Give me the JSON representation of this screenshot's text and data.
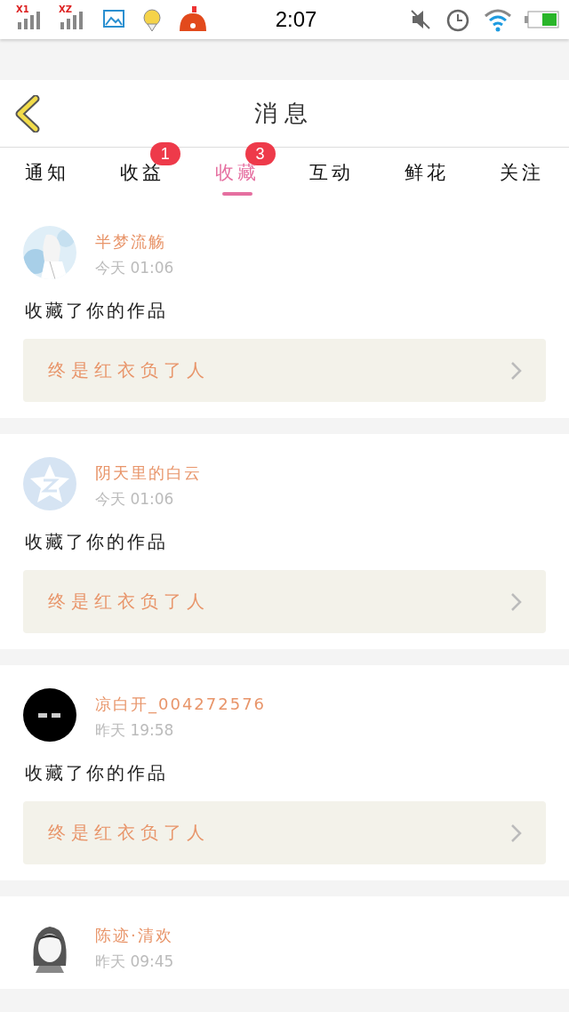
{
  "status_bar": {
    "sim_labels": [
      "X1",
      "XZ"
    ],
    "time": "2:07"
  },
  "header": {
    "title": "消息"
  },
  "tabs": [
    {
      "label": "通知",
      "selected": false
    },
    {
      "label": "收益",
      "selected": false,
      "badge": "1"
    },
    {
      "label": "收藏",
      "selected": true,
      "badge": "3"
    },
    {
      "label": "互动",
      "selected": false
    },
    {
      "label": "鲜花",
      "selected": false
    },
    {
      "label": "关注",
      "selected": false
    }
  ],
  "messages": [
    {
      "user": "半梦流觞",
      "time": "今天 01:06",
      "action": "收藏了你的作品",
      "work": "终是红衣负了人"
    },
    {
      "user": "阴天里的白云",
      "time": "今天 01:06",
      "action": "收藏了你的作品",
      "work": "终是红衣负了人",
      "avatar": {
        "kind": "default"
      }
    },
    {
      "user": "凉白开_004272576",
      "time": "昨天 19:58",
      "action": "收藏了你的作品",
      "work": "终是红衣负了人",
      "avatar": {
        "kind": "dark"
      }
    },
    {
      "user": "陈迹·清欢",
      "time": "昨天 09:45",
      "avatar": {
        "kind": "sketch"
      }
    }
  ]
}
